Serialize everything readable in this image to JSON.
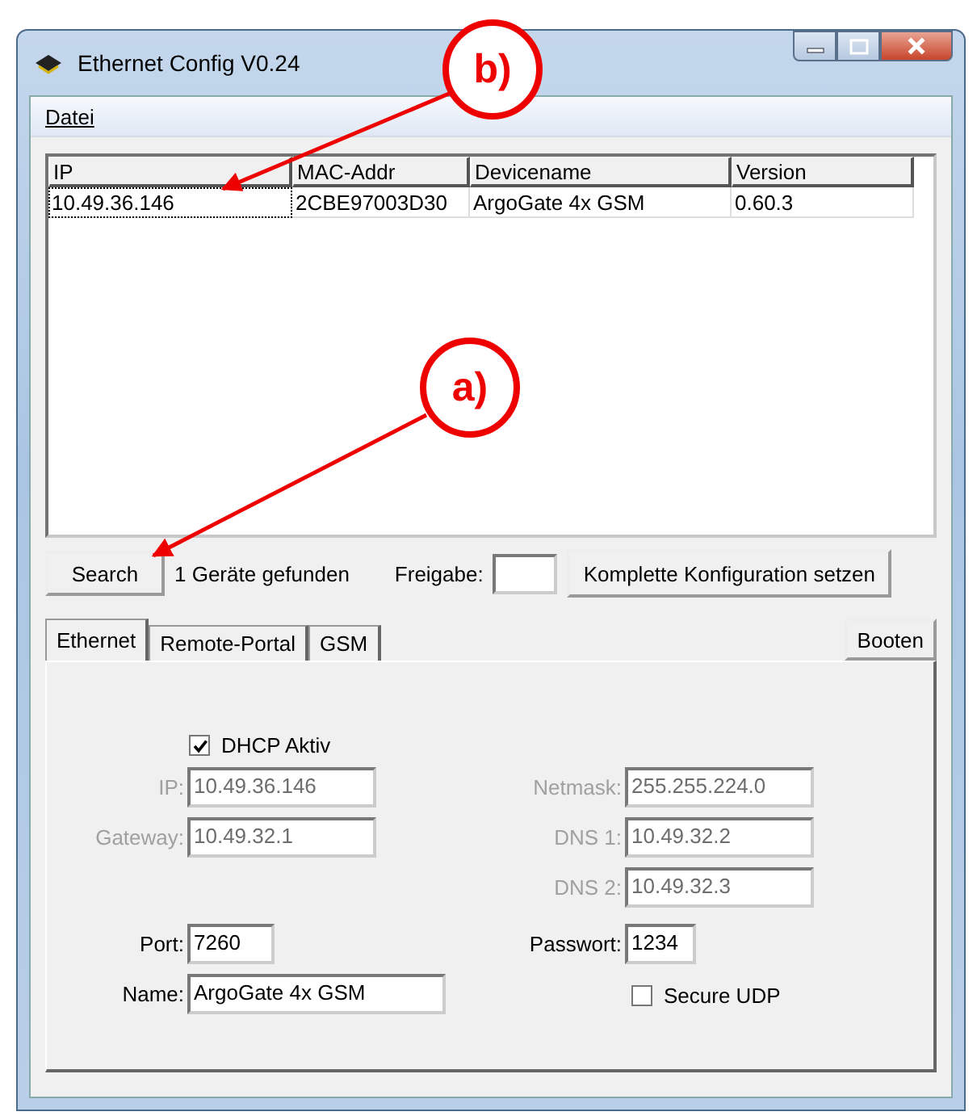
{
  "window": {
    "title": "Ethernet Config V0.24"
  },
  "menu": [
    "Datei"
  ],
  "device_list": {
    "columns": [
      "IP",
      "MAC-Addr",
      "Devicename",
      "Version"
    ],
    "rows": [
      {
        "cells": [
          "10.49.36.146",
          "2CBE97003D30",
          "ArgoGate 4x GSM",
          "0.60.3"
        ],
        "selected": true
      }
    ]
  },
  "toolbar": {
    "search_button": "Search",
    "status": "1 Geräte gefunden",
    "freigabe_label": "Freigabe:",
    "apply_button": "Komplette Konfiguration setzen"
  },
  "tabs": [
    {
      "label": "Ethernet",
      "selected": true
    },
    {
      "label": "Remote-Portal",
      "selected": false
    },
    {
      "label": "GSM",
      "selected": false
    }
  ],
  "boot_button": "Booten",
  "dhcp": {
    "label": "DHCP Aktiv",
    "checked": true
  },
  "network_fields": {
    "left": [
      {
        "label": "IP:",
        "value": "10.49.36.146",
        "disabled": true
      },
      {
        "label": "Gateway:",
        "value": "10.49.32.1",
        "disabled": true
      }
    ],
    "right": [
      {
        "label": "Netmask:",
        "value": "255.255.224.0",
        "disabled": true
      },
      {
        "label": "DNS 1:",
        "value": "10.49.32.2",
        "disabled": true
      },
      {
        "label": "DNS 2:",
        "value": "10.49.32.3",
        "disabled": true
      }
    ]
  },
  "port": {
    "label": "Port:",
    "value": "7260",
    "disabled": false
  },
  "password": {
    "label": "Passwort:",
    "value": "1234",
    "disabled": false
  },
  "name": {
    "label": "Name:",
    "value": "ArgoGate 4x GSM",
    "disabled": false
  },
  "secure_udp": {
    "label": "Secure UDP",
    "checked": false
  },
  "annotations": [
    {
      "label": "b)"
    },
    {
      "label": "a)"
    }
  ]
}
